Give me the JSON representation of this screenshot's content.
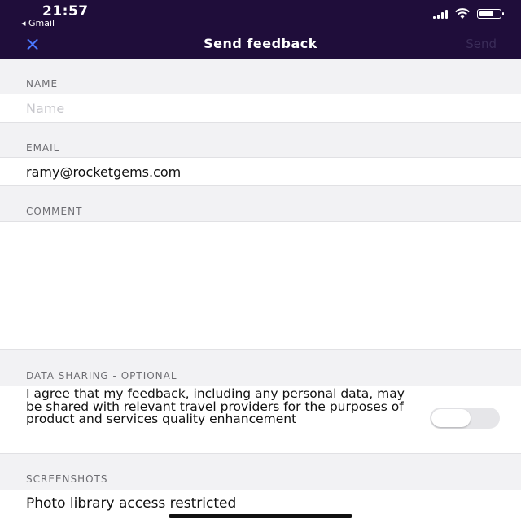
{
  "status_bar": {
    "time": "21:57",
    "back_app": "◂ Gmail",
    "battery_level": 0.75
  },
  "nav": {
    "close_icon": "×",
    "title": "Send feedback",
    "send_label": "Send"
  },
  "form": {
    "name": {
      "label": "NAME",
      "placeholder": "Name",
      "value": ""
    },
    "email": {
      "label": "EMAIL",
      "value": "ramy@rocketgems.com"
    },
    "comment": {
      "label": "COMMENT",
      "value": ""
    },
    "data_sharing": {
      "label": "DATA SHARING - OPTIONAL",
      "consent_text": "I agree that my feedback, including any personal data, may be shared with relevant travel providers for the purposes of product and services quality enhancement",
      "toggle_on": false
    },
    "screenshots": {
      "label": "SCREENSHOTS",
      "status_text": "Photo library access restricted"
    }
  },
  "colors": {
    "header_bg": "#1f0d3a",
    "close_accent": "#4a78ff",
    "send_disabled": "#3a2c58",
    "page_bg": "#f2f2f4"
  }
}
